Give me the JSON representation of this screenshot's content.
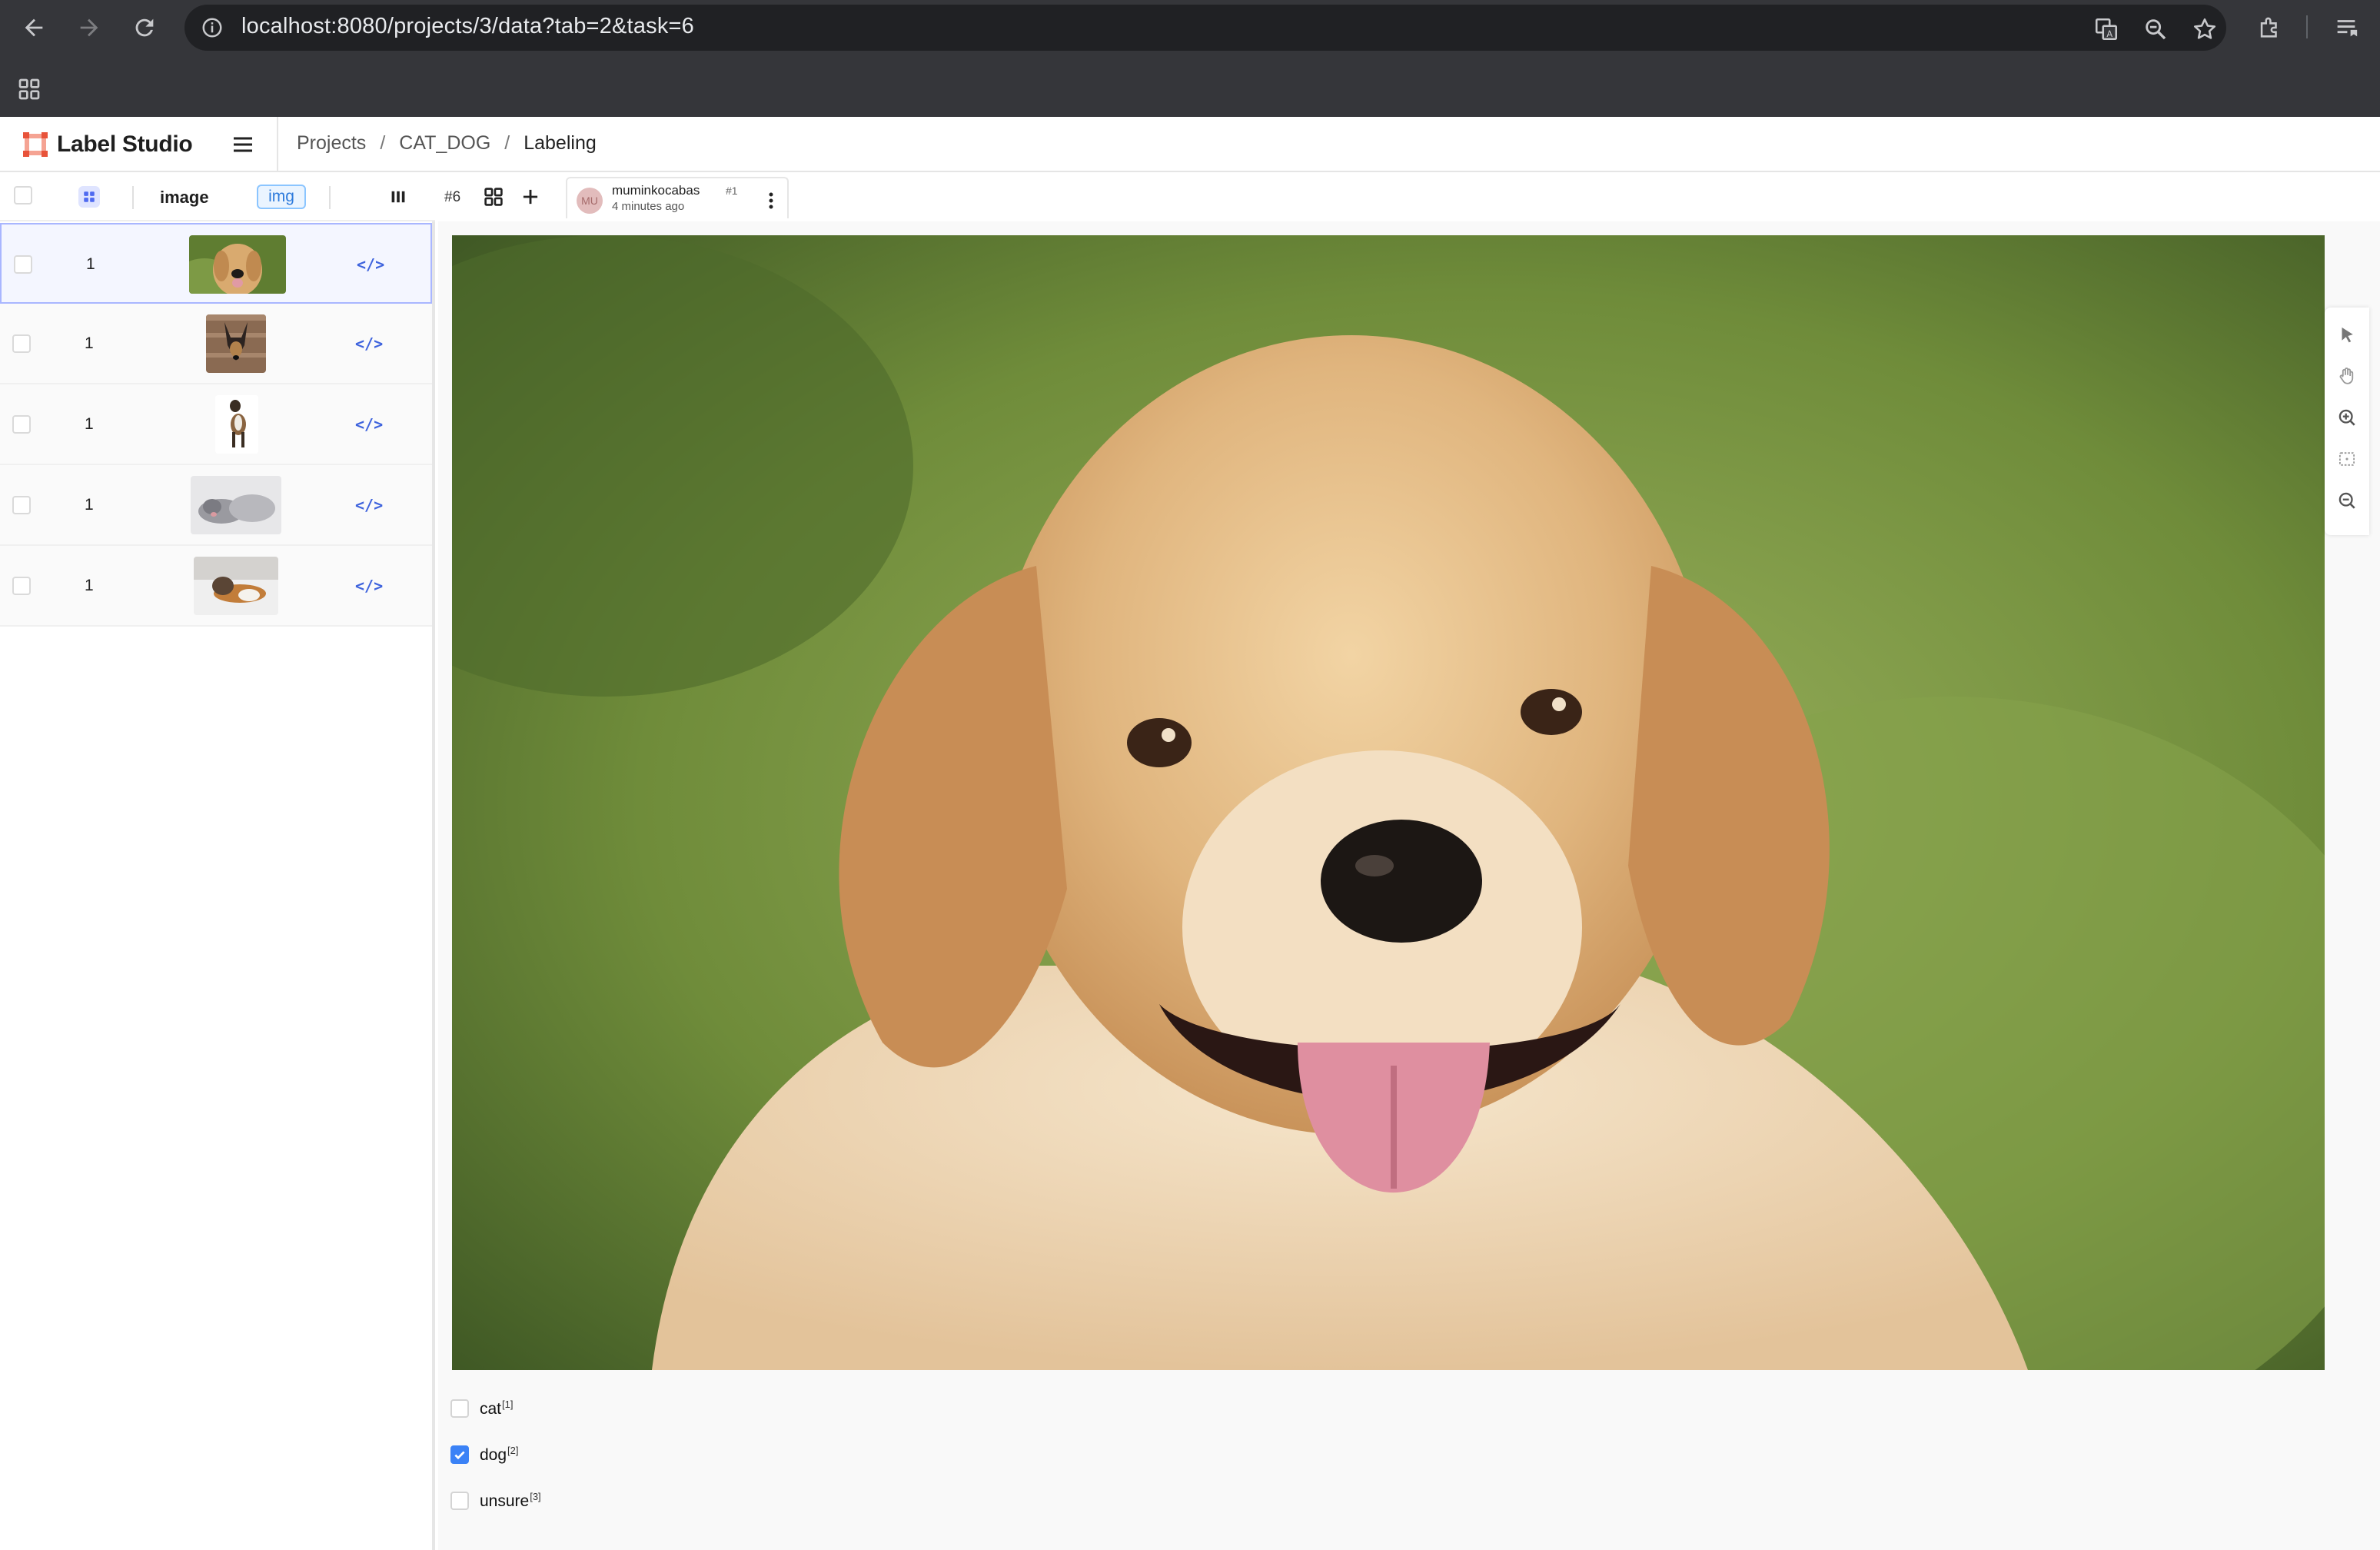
{
  "browser": {
    "url": "localhost:8080/projects/3/data?tab=2&task=6"
  },
  "app": {
    "brand": "Label Studio",
    "breadcrumb": {
      "projects": "Projects",
      "sep1": "/",
      "project": "CAT_DOG",
      "sep2": "/",
      "current": "Labeling"
    }
  },
  "table": {
    "columns": {
      "image": "image",
      "img_badge": "img"
    },
    "rows": [
      {
        "count": "1",
        "thumb": "golden-retriever",
        "code": "</>",
        "selected": true
      },
      {
        "count": "1",
        "thumb": "german-shepherd",
        "code": "</>",
        "selected": false
      },
      {
        "count": "1",
        "thumb": "small-dog",
        "code": "</>",
        "selected": false
      },
      {
        "count": "1",
        "thumb": "grey-cats",
        "code": "</>",
        "selected": false
      },
      {
        "count": "1",
        "thumb": "calico-cat",
        "code": "</>",
        "selected": false
      }
    ]
  },
  "annotation": {
    "task_id": "#6",
    "avatar": "MU",
    "user": "muminkocabas",
    "number": "#1",
    "time": "4 minutes ago"
  },
  "choices": [
    {
      "label": "cat",
      "hotkey": "[1]",
      "checked": false
    },
    {
      "label": "dog",
      "hotkey": "[2]",
      "checked": true
    },
    {
      "label": "unsure",
      "hotkey": "[3]",
      "checked": false
    }
  ],
  "colors": {
    "accent": "#3b82f6",
    "code_link": "#3e63dd",
    "brand_mark": "#e8533a"
  }
}
